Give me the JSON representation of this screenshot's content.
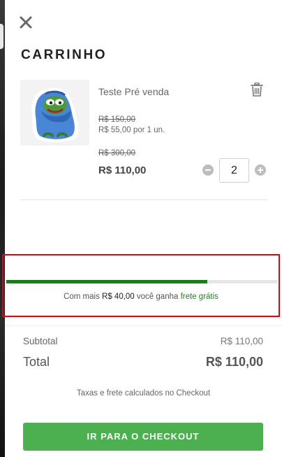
{
  "drawer": {
    "title": "CARRINHO",
    "close_icon": "close-icon"
  },
  "item": {
    "name": "Teste Pré venda",
    "unit_price_old": "R$ 150,00",
    "unit_price_new": "R$ 55,00 por 1 un.",
    "line_price_old": "R$ 300,00",
    "line_price_new": "R$ 110,00",
    "quantity": "2",
    "thumbnail_icon": "frog-blanket-sticker",
    "remove_icon": "trash-icon"
  },
  "free_shipping": {
    "progress": 0.74,
    "prefix": "Com mais ",
    "amount": "R$ 40,00",
    "middle": " você ganha ",
    "highlight": "frete grátis",
    "bar_color": "#1f7a1f",
    "highlight_border_color": "#e3000f"
  },
  "summary": {
    "subtotal_label": "Subtotal",
    "subtotal_value": "R$ 110,00",
    "total_label": "Total",
    "total_value": "R$ 110,00",
    "tax_note": "Taxas e frete calculados no Checkout"
  },
  "checkout": {
    "label": "IR PARA O CHECKOUT",
    "color": "#4caf50"
  }
}
